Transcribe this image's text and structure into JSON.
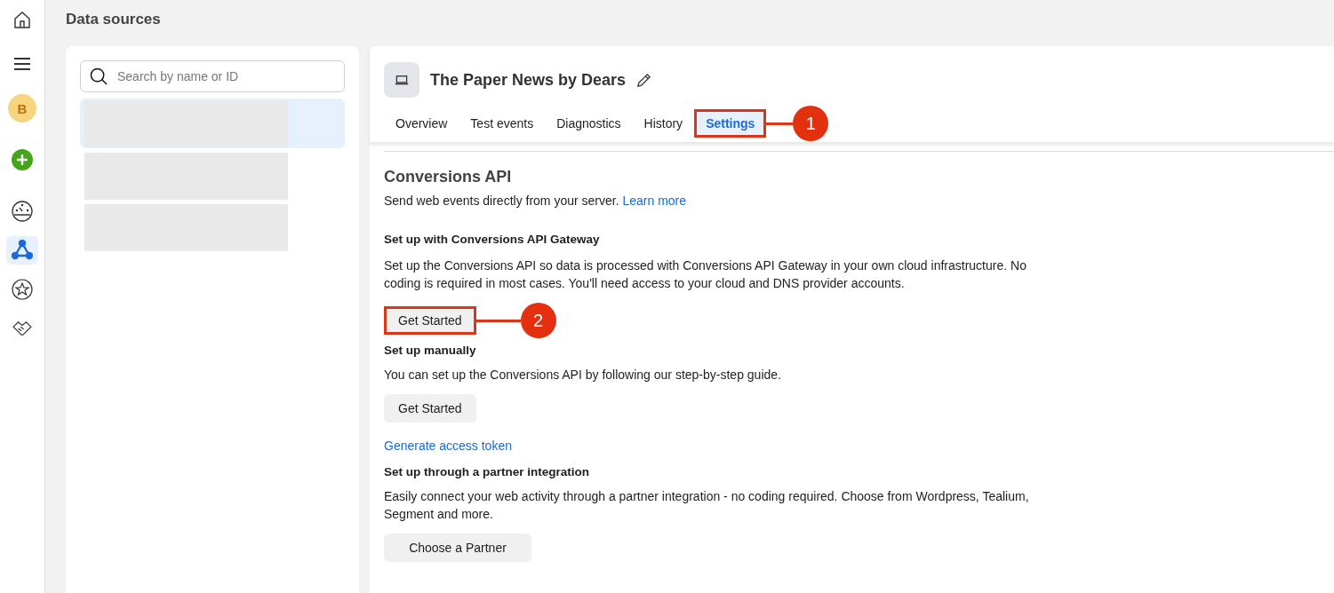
{
  "rail": {
    "items": [
      {
        "kind": "home",
        "selected": false
      },
      {
        "kind": "menu",
        "selected": false
      },
      {
        "kind": "avatar",
        "label": "B",
        "selected": false
      },
      {
        "kind": "add",
        "selected": false
      },
      {
        "kind": "gauge",
        "selected": false
      },
      {
        "kind": "nodes",
        "selected": true
      },
      {
        "kind": "star",
        "selected": false
      },
      {
        "kind": "handshake",
        "selected": false
      }
    ]
  },
  "page_title": "Data sources",
  "source_list": {
    "search": {
      "placeholder": "Search by name or ID"
    },
    "items": [
      {
        "selected": true
      },
      {
        "selected": false
      },
      {
        "selected": false
      }
    ]
  },
  "detail": {
    "title": "The Paper News by Dears",
    "tabs": [
      {
        "label": "Overview",
        "selected": false
      },
      {
        "label": "Test events",
        "selected": false
      },
      {
        "label": "Diagnostics",
        "selected": false
      },
      {
        "label": "History",
        "selected": false
      },
      {
        "label": "Settings",
        "selected": true,
        "callout": "1"
      }
    ],
    "heading": "Conversions API",
    "intro": "Send web events directly from your server.",
    "intro_link": "Learn more",
    "sections": [
      {
        "heading": "Set up with Conversions API Gateway",
        "text": "Set up the Conversions API so data is processed with Conversions API Gateway in your own cloud infrastructure. No coding is required in most cases. You'll need access to your cloud and DNS provider accounts.",
        "button": "Get Started",
        "callout": "2"
      },
      {
        "heading": "Set up manually",
        "text": "You can set up the Conversions API by following our step-by-step guide.",
        "button": "Get Started",
        "link": "Generate access token"
      },
      {
        "heading": "Set up through a partner integration",
        "text": "Easily connect your web activity through a partner integration - no coding required. Choose from Wordpress, Tealium, Segment and more.",
        "button": "Choose a Partner"
      }
    ]
  }
}
